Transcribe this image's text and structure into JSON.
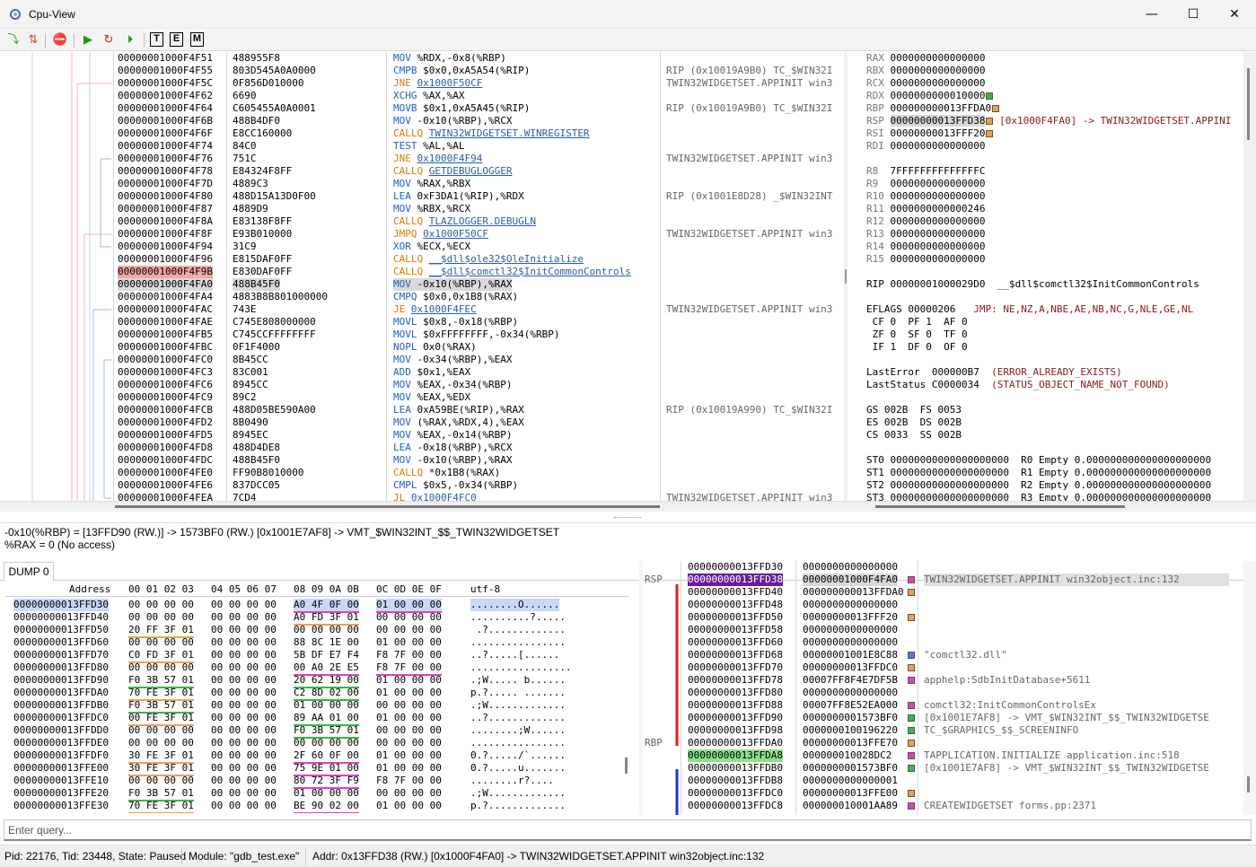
{
  "window": {
    "title": "Cpu-View",
    "minimize": "—",
    "maximize": "☐",
    "close": "✕"
  },
  "toolbar": {
    "t_label": "T",
    "e_label": "E",
    "m_label": "M"
  },
  "colors": {
    "breakpoint": "#f4a7a3",
    "rsp": "#6a1b9a",
    "rbp": "#8be08b",
    "mnemonic": "#2060c0",
    "call": "#e07800",
    "link": "#2b5ea8"
  },
  "asm": [
    {
      "addr": "00000001000F4F51",
      "bytes": "488955F8",
      "mn": "MOV",
      "ops": "%RDX,-0x8(%RBP)",
      "info": ""
    },
    {
      "addr": "00000001000F4F55",
      "bytes": "803D545A0A0000",
      "mn": "CMPB",
      "ops": "$0x0,0xA5A54(%RIP)",
      "info": "RIP (0x10019A9B0) TC_$WIN32I"
    },
    {
      "addr": "00000001000F4F5C",
      "bytes": "0F856D010000",
      "mn": "JNE",
      "ops": "0x1000F50CF",
      "info": "TWIN32WIDGETSET.APPINIT win3"
    },
    {
      "addr": "00000001000F4F62",
      "bytes": "6690",
      "mn": "XCHG",
      "ops": "%AX,%AX",
      "info": ""
    },
    {
      "addr": "00000001000F4F64",
      "bytes": "C605455A0A0001",
      "mn": "MOVB",
      "ops": "$0x1,0xA5A45(%RIP)",
      "info": "RIP (0x10019A9B0) TC_$WIN32I"
    },
    {
      "addr": "00000001000F4F6B",
      "bytes": "488B4DF0",
      "mn": "MOV",
      "ops": "-0x10(%RBP),%RCX",
      "info": ""
    },
    {
      "addr": "00000001000F4F6F",
      "bytes": "E8CC160000",
      "mn": "CALLQ",
      "ops": "TWIN32WIDGETSET.WINREGISTER",
      "info": ""
    },
    {
      "addr": "00000001000F4F74",
      "bytes": "84C0",
      "mn": "TEST",
      "ops": "%AL,%AL",
      "info": ""
    },
    {
      "addr": "00000001000F4F76",
      "bytes": "751C",
      "mn": "JNE",
      "ops": "0x1000F4F94",
      "info": "TWIN32WIDGETSET.APPINIT win3"
    },
    {
      "addr": "00000001000F4F78",
      "bytes": "E84324F8FF",
      "mn": "CALLQ",
      "ops": "GETDEBUGLOGGER",
      "info": ""
    },
    {
      "addr": "00000001000F4F7D",
      "bytes": "4889C3",
      "mn": "MOV",
      "ops": "%RAX,%RBX",
      "info": ""
    },
    {
      "addr": "00000001000F4F80",
      "bytes": "488D15A13D0F00",
      "mn": "LEA",
      "ops": "0xF3DA1(%RIP),%RDX",
      "info": "RIP (0x1001E8D28) _$WIN32INT"
    },
    {
      "addr": "00000001000F4F87",
      "bytes": "4889D9",
      "mn": "MOV",
      "ops": "%RBX,%RCX",
      "info": ""
    },
    {
      "addr": "00000001000F4F8A",
      "bytes": "E83138F8FF",
      "mn": "CALLQ",
      "ops": "TLAZLOGGER.DEBUGLN",
      "info": ""
    },
    {
      "addr": "00000001000F4F8F",
      "bytes": "E93B010000",
      "mn": "JMPQ",
      "ops": "0x1000F50CF",
      "info": "TWIN32WIDGETSET.APPINIT win3"
    },
    {
      "addr": "00000001000F4F94",
      "bytes": "31C9",
      "mn": "XOR",
      "ops": "%ECX,%ECX",
      "info": ""
    },
    {
      "addr": "00000001000F4F96",
      "bytes": "E815DAF0FF",
      "mn": "CALLQ",
      "ops": "__$dll$ole32$OleInitialize",
      "info": ""
    },
    {
      "addr": "00000001000F4F9B",
      "bytes": "E830DAF0FF",
      "mn": "CALLQ",
      "ops": "__$dll$comctl32$InitCommonControls",
      "info": ""
    },
    {
      "addr": "00000001000F4FA0",
      "bytes": "488B45F0",
      "mn": "MOV",
      "ops": "-0x10(%RBP),%RAX",
      "info": ""
    },
    {
      "addr": "00000001000F4FA4",
      "bytes": "4883B8B801000000",
      "mn": "CMPQ",
      "ops": "$0x0,0x1B8(%RAX)",
      "info": ""
    },
    {
      "addr": "00000001000F4FAC",
      "bytes": "743E",
      "mn": "JE",
      "ops": "0x1000F4FEC",
      "info": "TWIN32WIDGETSET.APPINIT win3"
    },
    {
      "addr": "00000001000F4FAE",
      "bytes": "C745E808000000",
      "mn": "MOVL",
      "ops": "$0x8,-0x18(%RBP)",
      "info": ""
    },
    {
      "addr": "00000001000F4FB5",
      "bytes": "C745CCFFFFFFFF",
      "mn": "MOVL",
      "ops": "$0xFFFFFFFF,-0x34(%RBP)",
      "info": ""
    },
    {
      "addr": "00000001000F4FBC",
      "bytes": "0F1F4000",
      "mn": "NOPL",
      "ops": "0x0(%RAX)",
      "info": ""
    },
    {
      "addr": "00000001000F4FC0",
      "bytes": "8B45CC",
      "mn": "MOV",
      "ops": "-0x34(%RBP),%EAX",
      "info": ""
    },
    {
      "addr": "00000001000F4FC3",
      "bytes": "83C001",
      "mn": "ADD",
      "ops": "$0x1,%EAX",
      "info": ""
    },
    {
      "addr": "00000001000F4FC6",
      "bytes": "8945CC",
      "mn": "MOV",
      "ops": "%EAX,-0x34(%RBP)",
      "info": ""
    },
    {
      "addr": "00000001000F4FC9",
      "bytes": "89C2",
      "mn": "MOV",
      "ops": "%EAX,%EDX",
      "info": ""
    },
    {
      "addr": "00000001000F4FCB",
      "bytes": "488D05BE590A00",
      "mn": "LEA",
      "ops": "0xA59BE(%RIP),%RAX",
      "info": "RIP (0x10019A990) TC_$WIN32I"
    },
    {
      "addr": "00000001000F4FD2",
      "bytes": "8B0490",
      "mn": "MOV",
      "ops": "(%RAX,%RDX,4),%EAX",
      "info": ""
    },
    {
      "addr": "00000001000F4FD5",
      "bytes": "8945EC",
      "mn": "MOV",
      "ops": "%EAX,-0x14(%RBP)",
      "info": ""
    },
    {
      "addr": "00000001000F4FD8",
      "bytes": "488D4DE8",
      "mn": "LEA",
      "ops": "-0x18(%RBP),%RCX",
      "info": ""
    },
    {
      "addr": "00000001000F4FDC",
      "bytes": "488B45F0",
      "mn": "MOV",
      "ops": "-0x10(%RBP),%RAX",
      "info": ""
    },
    {
      "addr": "00000001000F4FE0",
      "bytes": "FF90B8010000",
      "mn": "CALLQ",
      "ops": "*0x1B8(%RAX)",
      "info": ""
    },
    {
      "addr": "00000001000F4FE6",
      "bytes": "837DCC05",
      "mn": "CMPL",
      "ops": "$0x5,-0x34(%RBP)",
      "info": ""
    },
    {
      "addr": "00000001000F4FEA",
      "bytes": "7CD4",
      "mn": "JL",
      "ops": "0x1000F4FC0",
      "info": "TWIN32WIDGETSET.APPINIT win3"
    }
  ],
  "registers": [
    {
      "n": "RAX",
      "v": "0000000000000000",
      "d": "",
      "x": ""
    },
    {
      "n": "RBX",
      "v": "0000000000000000",
      "d": "",
      "x": ""
    },
    {
      "n": "RCX",
      "v": "0000000000000000",
      "d": "",
      "x": ""
    },
    {
      "n": "RDX",
      "v": "0000000000010000",
      "d": "#39b54a",
      "x": ""
    },
    {
      "n": "RBP",
      "v": "000000000013FFDA0",
      "d": "#f0a040",
      "x": ""
    },
    {
      "n": "RSP",
      "v": "00000000013FFD38",
      "d": "#f0a040",
      "x": "[0x1000F4FA0] -> TWIN32WIDGETSET.APPINI"
    },
    {
      "n": "RSI",
      "v": "00000000013FFF20",
      "d": "#f0a040",
      "x": ""
    },
    {
      "n": "RDI",
      "v": "0000000000000000",
      "d": "",
      "x": ""
    },
    {
      "n": "",
      "v": "",
      "d": "",
      "x": ""
    },
    {
      "n": "R8 ",
      "v": "7FFFFFFFFFFFFFFC",
      "d": "",
      "x": ""
    },
    {
      "n": "R9 ",
      "v": "0000000000000000",
      "d": "",
      "x": ""
    },
    {
      "n": "R10",
      "v": "0000000000000000",
      "d": "",
      "x": ""
    },
    {
      "n": "R11",
      "v": "0000000000000246",
      "d": "",
      "x": ""
    },
    {
      "n": "R12",
      "v": "0000000000000000",
      "d": "",
      "x": ""
    },
    {
      "n": "R13",
      "v": "0000000000000000",
      "d": "",
      "x": ""
    },
    {
      "n": "R14",
      "v": "0000000000000000",
      "d": "",
      "x": ""
    },
    {
      "n": "R15",
      "v": "0000000000000000",
      "d": "",
      "x": ""
    }
  ],
  "regs_extra": {
    "rip": "RIP 00000001000029D0  __$dll$comctl32$InitCommonControls",
    "eflags": "EFLAGS 00000206",
    "jmp": "JMP: NE,NZ,A,NBE,AE,NB,NC,G,NLE,GE,NL",
    "flags1": " CF 0  PF 1  AF 0",
    "flags2": " ZF 0  SF 0  TF 0",
    "flags3": " IF 1  DF 0  OF 0",
    "lasterror": "LastError  000000B7",
    "lasterror_name": "(ERROR_ALREADY_EXISTS)",
    "laststatus": "LastStatus C0000034",
    "laststatus_name": "(STATUS_OBJECT_NAME_NOT_FOUND)",
    "seg1": "GS 002B  FS 0053",
    "seg2": "ES 002B  DS 002B",
    "seg3": "CS 0033  SS 002B",
    "st": [
      "ST0 00000000000000000000  R0 Empty 0.000000000000000000000",
      "ST1 00000000000000000000  R1 Empty 0.000000000000000000000",
      "ST2 00000000000000000000  R2 Empty 0.000000000000000000000",
      "ST3 00000000000000000000  R3 Empty 0.000000000000000000000"
    ]
  },
  "expression": {
    "line1": "-0x10(%RBP) = [13FFD90 (RW.)] -> 1573BF0 (RW.) [0x1001E7AF8] -> VMT_$WIN32INT_$$_TWIN32WIDGETSET",
    "line2": "%RAX = 0 (No access)"
  },
  "dump": {
    "tab": "DUMP 0",
    "headers": {
      "address": "Address",
      "g1": "00 01 02 03",
      "g2": "04 05 06 07",
      "g3": "08 09 0A 0B",
      "g4": "0C 0D 0E 0F",
      "text": "utf-8"
    },
    "rows": [
      {
        "a": "00000000013FFD30",
        "g": [
          "00 00 00 00",
          "00 00 00 00",
          "A0 4F 0F 00",
          "01 00 00 00"
        ],
        "u": [
          "",
          "",
          "p",
          "p"
        ],
        "t": "........O......"
      },
      {
        "a": "00000000013FFD40",
        "g": [
          "00 00 00 00",
          "00 00 00 00",
          "A0 FD 3F 01",
          "00 00 00 00"
        ],
        "u": [
          "",
          "",
          "o",
          ""
        ],
        "t": "..........?....."
      },
      {
        "a": "00000000013FFD50",
        "g": [
          "20 FF 3F 01",
          "00 00 00 00",
          "00 00 00 00",
          "00 00 00 00"
        ],
        "u": [
          "o",
          "",
          "",
          ""
        ],
        "t": " .?............."
      },
      {
        "a": "00000000013FFD60",
        "g": [
          "00 00 00 00",
          "00 00 00 00",
          "88 8C 1E 00",
          "01 00 00 00"
        ],
        "u": [
          "",
          "",
          "",
          ""
        ],
        "t": "................"
      },
      {
        "a": "00000000013FFD70",
        "g": [
          "C0 FD 3F 01",
          "00 00 00 00",
          "5B DF E7 F4",
          "F8 7F 00 00"
        ],
        "u": [
          "o",
          "",
          "",
          ""
        ],
        "t": "..?.....[......"
      },
      {
        "a": "00000000013FFD80",
        "g": [
          "00 00 00 00",
          "00 00 00 00",
          "00 A0 2E E5",
          "F8 7F 00 00"
        ],
        "u": [
          "",
          "",
          "p",
          "p"
        ],
        "t": "................."
      },
      {
        "a": "00000000013FFD90",
        "g": [
          "F0 3B 57 01",
          "00 00 00 00",
          "20 62 19 00",
          "01 00 00 00"
        ],
        "u": [
          "g",
          "",
          "g",
          ""
        ],
        "t": ".;W..... b......"
      },
      {
        "a": "00000000013FFDA0",
        "g": [
          "70 FE 3F 01",
          "00 00 00 00",
          "C2 8D 02 00",
          "01 00 00 00"
        ],
        "u": [
          "o",
          "",
          "g",
          ""
        ],
        "t": "p.?..... ......."
      },
      {
        "a": "00000000013FFDB0",
        "g": [
          "F0 3B 57 01",
          "00 00 00 00",
          "01 00 00 00",
          "00 00 00 00"
        ],
        "u": [
          "g",
          "",
          "",
          ""
        ],
        "t": ".;W............."
      },
      {
        "a": "00000000013FFDC0",
        "g": [
          "00 FE 3F 01",
          "00 00 00 00",
          "89 AA 01 00",
          "01 00 00 00"
        ],
        "u": [
          "o",
          "",
          "g",
          ""
        ],
        "t": "..?............."
      },
      {
        "a": "00000000013FFDD0",
        "g": [
          "00 00 00 00",
          "00 00 00 00",
          "F0 3B 57 01",
          "00 00 00 00"
        ],
        "u": [
          "",
          "",
          "g",
          ""
        ],
        "t": "........;W......"
      },
      {
        "a": "00000000013FFDE0",
        "g": [
          "00 00 00 00",
          "00 00 00 00",
          "00 00 00 00",
          "00 00 00 00"
        ],
        "u": [
          "",
          "",
          "",
          ""
        ],
        "t": "................"
      },
      {
        "a": "00000000013FFDF0",
        "g": [
          "30 FE 3F 01",
          "00 00 00 00",
          "2F 60 0F 00",
          "01 00 00 00"
        ],
        "u": [
          "o",
          "",
          "p",
          ""
        ],
        "t": "0.?...../`......"
      },
      {
        "a": "00000000013FFE00",
        "g": [
          "30 FE 3F 01",
          "00 00 00 00",
          "75 9E 01 00",
          "01 00 00 00"
        ],
        "u": [
          "o",
          "",
          "p",
          ""
        ],
        "t": "0.?.....u......."
      },
      {
        "a": "00000000013FFE10",
        "g": [
          "00 00 00 00",
          "00 00 00 00",
          "80 72 3F F9",
          "F8 7F 00 00"
        ],
        "u": [
          "",
          "",
          "p",
          ""
        ],
        "t": "........r?...."
      },
      {
        "a": "00000000013FFE20",
        "g": [
          "F0 3B 57 01",
          "00 00 00 00",
          "01 00 00 00",
          "00 00 00 00"
        ],
        "u": [
          "g",
          "",
          "",
          ""
        ],
        "t": ".;W............."
      },
      {
        "a": "00000000013FFE30",
        "g": [
          "70 FE 3F 01",
          "00 00 00 00",
          "BE 90 02 00",
          "01 00 00 00"
        ],
        "u": [
          "o",
          "",
          "p",
          ""
        ],
        "t": "p.?............."
      }
    ]
  },
  "stack": {
    "rsp_label": "RSP",
    "rbp_label": "RBP",
    "rows": [
      {
        "a": "00000000013FFD30",
        "v": "0000000000000000",
        "d": "",
        "i": ""
      },
      {
        "a": "00000000013FFD38",
        "v": "00000001000F4FA0",
        "d": "#e040c0",
        "i": "TWIN32WIDGETSET.APPINIT win32object.inc:132"
      },
      {
        "a": "00000000013FFD40",
        "v": "000000000013FFDA0",
        "d": "#f0a040",
        "i": ""
      },
      {
        "a": "00000000013FFD48",
        "v": "0000000000000000",
        "d": "",
        "i": ""
      },
      {
        "a": "00000000013FFD50",
        "v": "00000000013FFF20",
        "d": "#f0a040",
        "i": ""
      },
      {
        "a": "00000000013FFD58",
        "v": "0000000000000000",
        "d": "",
        "i": ""
      },
      {
        "a": "00000000013FFD60",
        "v": "0000000000000000",
        "d": "",
        "i": ""
      },
      {
        "a": "00000000013FFD68",
        "v": "00000001001E8C88",
        "d": "#5577dd",
        "i": "\"comctl32.dll\""
      },
      {
        "a": "00000000013FFD70",
        "v": "00000000013FFDC0",
        "d": "#f0a040",
        "i": ""
      },
      {
        "a": "00000000013FFD78",
        "v": "00007FF8F4E7DF5B",
        "d": "#e040c0",
        "i": "apphelp:SdbInitDatabase+5611"
      },
      {
        "a": "00000000013FFD80",
        "v": "0000000000000000",
        "d": "",
        "i": ""
      },
      {
        "a": "00000000013FFD88",
        "v": "00007FF8E52EA000",
        "d": "#e040c0",
        "i": "comctl32:InitCommonControlsEx"
      },
      {
        "a": "00000000013FFD90",
        "v": "0000000001573BF0",
        "d": "#39b54a",
        "i": "[0x1001E7AF8] -> VMT_$WIN32INT_$$_TWIN32WIDGETSE"
      },
      {
        "a": "00000000013FFD98",
        "v": "0000000100196220",
        "d": "#39b54a",
        "i": "TC_$GRAPHICS_$$_SCREENINFO"
      },
      {
        "a": "00000000013FFDA0",
        "v": "00000000013FFE70",
        "d": "#f0a040",
        "i": ""
      },
      {
        "a": "00000000013FFDA8",
        "v": "000000010028DC2",
        "d": "#e040c0",
        "i": "TAPPLICATION.INITIALIZE application.inc:518"
      },
      {
        "a": "00000000013FFDB0",
        "v": "0000000001573BF0",
        "d": "#39b54a",
        "i": "[0x1001E7AF8] -> VMT_$WIN32INT_$$_TWIN32WIDGETSE"
      },
      {
        "a": "00000000013FFDB8",
        "v": "0000000000000001",
        "d": "",
        "i": ""
      },
      {
        "a": "00000000013FFDC0",
        "v": "00000000013FFE00",
        "d": "#f0a040",
        "i": ""
      },
      {
        "a": "00000000013FFDC8",
        "v": "000000010001AA89",
        "d": "#e040c0",
        "i": "CREATEWIDGETSET forms.pp:2371"
      }
    ]
  },
  "query_placeholder": "Enter query...",
  "status": {
    "pid": "Pid: 22176, Tid: 23448, State: Paused",
    "module": "Module: \"gdb_test.exe\"",
    "addr": "Addr:  0x13FFD38 (RW.) [0x1000F4FA0] -> TWIN32WIDGETSET.APPINIT win32object.inc:132"
  }
}
